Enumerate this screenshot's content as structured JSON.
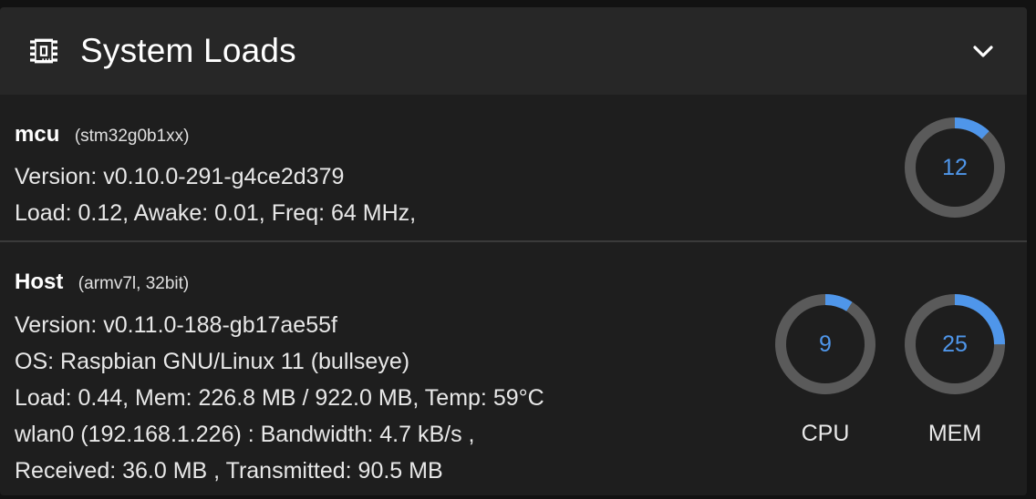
{
  "header": {
    "title": "System Loads",
    "icon": "chip-icon",
    "collapse_icon": "chevron-down-icon"
  },
  "colors": {
    "accent": "#4f96ea",
    "track": "#5a5a5a",
    "panel_bg": "#1e1e1e",
    "header_bg": "#272727"
  },
  "mcu": {
    "name": "mcu",
    "chip": "(stm32g0b1xx)",
    "version": "Version: v0.10.0-291-g4ce2d379",
    "load": "Load: 0.12, Awake: 0.01, Freq: 64 MHz,",
    "gauge": {
      "value": 12,
      "display": "12"
    }
  },
  "host": {
    "name": "Host",
    "arch": "(armv7l, 32bit)",
    "version": "Version: v0.11.0-188-gb17ae55f",
    "os": "OS: Raspbian GNU/Linux 11 (bullseye)",
    "load": "Load: 0.44, Mem: 226.8 MB / 922.0 MB, Temp: 59°C",
    "network": "wlan0 (192.168.1.226) : Bandwidth: 4.7 kB/s ,",
    "traffic": "Received: 36.0 MB , Transmitted: 90.5 MB",
    "cpu_gauge": {
      "value": 9,
      "display": "9",
      "label": "CPU"
    },
    "mem_gauge": {
      "value": 25,
      "display": "25",
      "label": "MEM"
    }
  }
}
